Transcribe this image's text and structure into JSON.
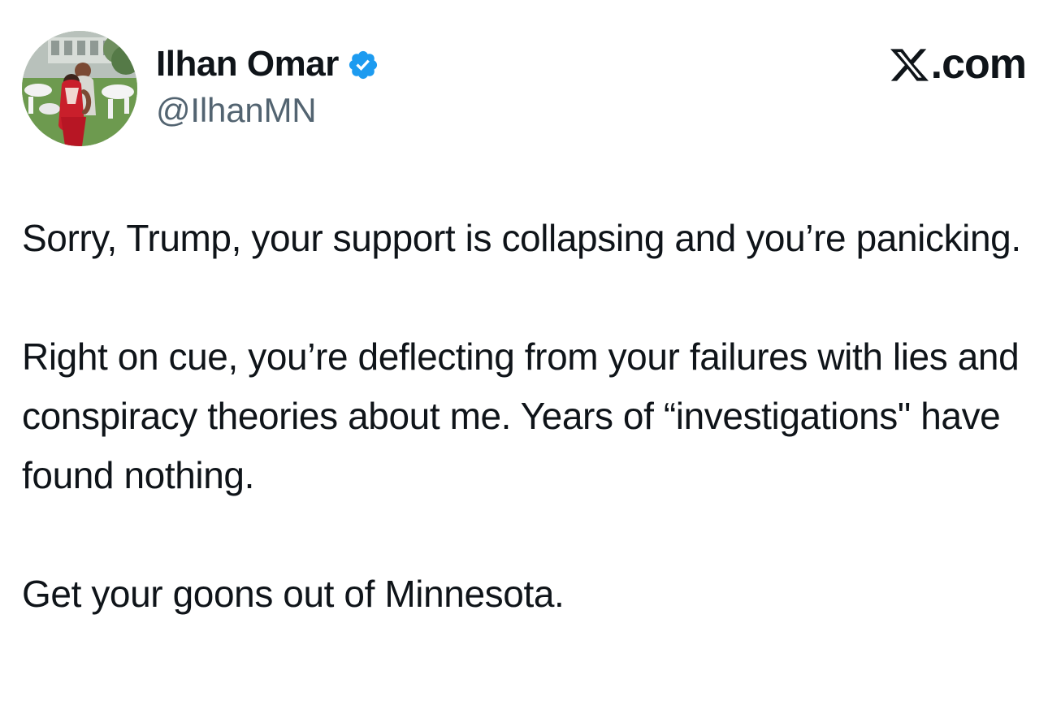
{
  "post": {
    "author": {
      "display_name": "Ilhan Omar",
      "handle": "@IlhanMN",
      "verified": true,
      "avatar_icon": "profile-photo"
    },
    "site_logo": {
      "icon": "x-logo-icon",
      "suffix": ".com"
    },
    "paragraphs": [
      "Sorry, Trump, your support is collapsing and you’re panicking.",
      "Right on cue, you’re deflecting from your failures with lies and conspiracy theories about me. Years of “investigations\" have found nothing.",
      "Get your goons out of Minnesota."
    ]
  },
  "colors": {
    "text_primary": "#0f1419",
    "text_secondary": "#536471",
    "verified_blue": "#1d9bf0",
    "background": "#ffffff"
  }
}
